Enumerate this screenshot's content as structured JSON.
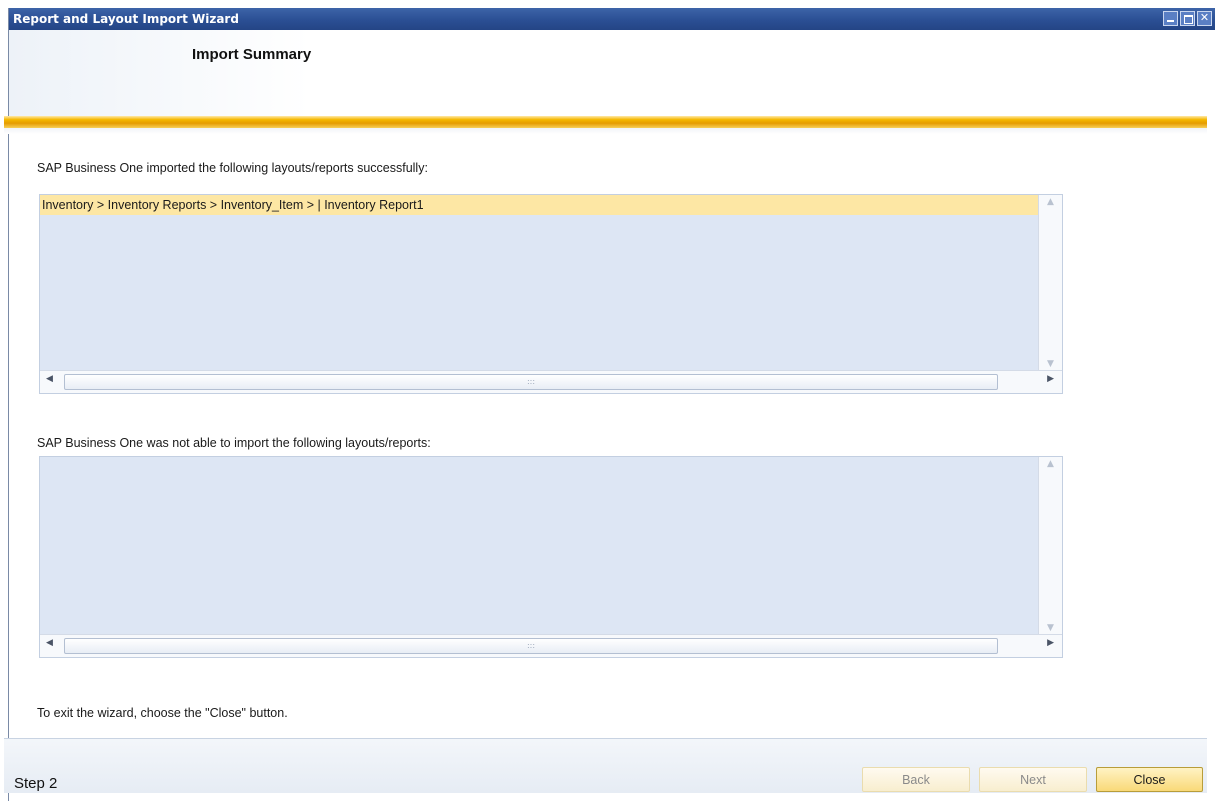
{
  "window": {
    "title": "Report and Layout Import Wizard",
    "controls": {
      "minimize": "minimize",
      "maximize": "maximize",
      "close": "✕"
    }
  },
  "header": {
    "page_title": "Import Summary"
  },
  "success_section": {
    "label": "SAP Business One imported the following layouts/reports successfully:",
    "items": [
      "Inventory > Inventory Reports > Inventory_Item > | Inventory Report1"
    ],
    "selected_index": 0
  },
  "failed_section": {
    "label": "SAP Business One was not able to import the following layouts/reports:",
    "items": []
  },
  "scroll_glyphs": {
    "up": "▲",
    "down": "▼",
    "left": "◀",
    "right": "▶",
    "grip": ":::"
  },
  "exit_hint": "To exit the wizard, choose the \"Close\" button.",
  "footer": {
    "step_label": "Step 2",
    "back_label": "Back",
    "next_label": "Next",
    "close_label": "Close"
  },
  "colors": {
    "title_bar": "#2b4f94",
    "accent": "#f5b800",
    "selection": "#fde7a4",
    "list_background": "#dde6f4"
  }
}
